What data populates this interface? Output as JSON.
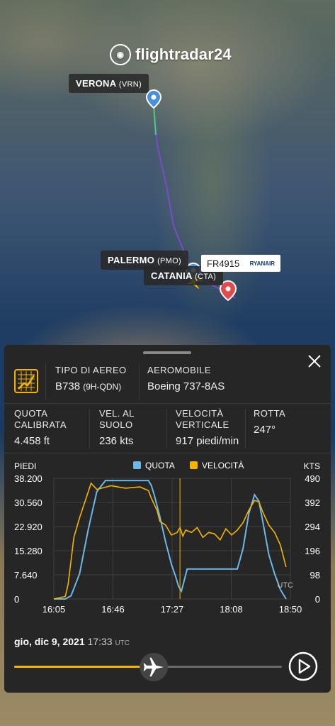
{
  "app": {
    "logo_text": "flightradar24"
  },
  "map": {
    "origin_label": "VERONA",
    "origin_code": "(VRN)",
    "waypoint_label": "PALERMO",
    "waypoint_code": "(PMO)",
    "dest_label": "CATANIA",
    "dest_code": "(CTA)",
    "flight_label": "FR4915",
    "airline_label": "RYANAIR"
  },
  "panel": {
    "aircraft_type_label": "TIPO DI AEREO",
    "aircraft_type_value": "B738",
    "aircraft_reg": "(9H-QDN)",
    "aircraft_label": "AEROMOBILE",
    "aircraft_value": "Boeing 737-8AS",
    "stats": [
      {
        "label": "QUOTA CALIBRATA",
        "value": "4.458 ft"
      },
      {
        "label": "VEL. AL SUOLO",
        "value": "236 kts"
      },
      {
        "label": "VELOCITÀ VERTICALE",
        "value": "917 piedi/min"
      },
      {
        "label": "ROTTA",
        "value": "247°"
      }
    ],
    "date": "gio, dic 9, 2021",
    "time": "17:33",
    "tz": "UTC",
    "playback_progress": 0.52
  },
  "chart_data": {
    "type": "line",
    "left_axis_label": "PIEDI",
    "right_axis_label": "KTS",
    "utc_label": "UTC",
    "legend": [
      {
        "name": "QUOTA",
        "color": "#6cb8e6"
      },
      {
        "name": "VELOCITÀ",
        "color": "#f4b400"
      }
    ],
    "y_left_ticks": [
      "38.200",
      "30.560",
      "22.920",
      "15.280",
      "7.640",
      "0"
    ],
    "y_right_ticks": [
      "490",
      "392",
      "294",
      "196",
      "98",
      "0"
    ],
    "x_ticks": [
      "16:05",
      "16:46",
      "17:27",
      "18:08",
      "18:50"
    ],
    "ylim_left": [
      0,
      38200
    ],
    "ylim_right": [
      0,
      490
    ],
    "xlim_minutes": [
      0,
      165
    ],
    "cursor_minute": 88,
    "altitude_series": {
      "name": "QUOTA",
      "x": [
        0,
        8,
        12,
        18,
        24,
        30,
        36,
        44,
        52,
        60,
        66,
        68,
        70,
        74,
        78,
        82,
        85,
        87,
        89,
        93,
        100,
        110,
        120,
        128,
        132,
        136,
        140,
        143,
        146,
        150,
        154,
        158,
        162
      ],
      "y": [
        0,
        0,
        1000,
        8000,
        22000,
        34000,
        37500,
        37500,
        37500,
        37500,
        37500,
        36000,
        33000,
        26000,
        18000,
        11000,
        7000,
        4000,
        2500,
        9500,
        9500,
        9500,
        9500,
        9500,
        16000,
        27000,
        33000,
        31000,
        24000,
        14000,
        8000,
        3000,
        0
      ]
    },
    "speed_series": {
      "name": "VELOCITÀ",
      "x": [
        0,
        8,
        10,
        14,
        18,
        22,
        26,
        30,
        40,
        50,
        60,
        66,
        68,
        72,
        74,
        78,
        82,
        86,
        88,
        90,
        92,
        96,
        100,
        104,
        108,
        112,
        116,
        120,
        124,
        128,
        132,
        136,
        140,
        143,
        146,
        150,
        154,
        158,
        162
      ],
      "y": [
        0,
        10,
        60,
        250,
        330,
        400,
        470,
        445,
        460,
        450,
        455,
        440,
        410,
        360,
        315,
        300,
        260,
        270,
        290,
        255,
        280,
        270,
        290,
        250,
        270,
        265,
        240,
        285,
        260,
        280,
        310,
        360,
        400,
        395,
        350,
        300,
        270,
        220,
        130
      ]
    }
  }
}
